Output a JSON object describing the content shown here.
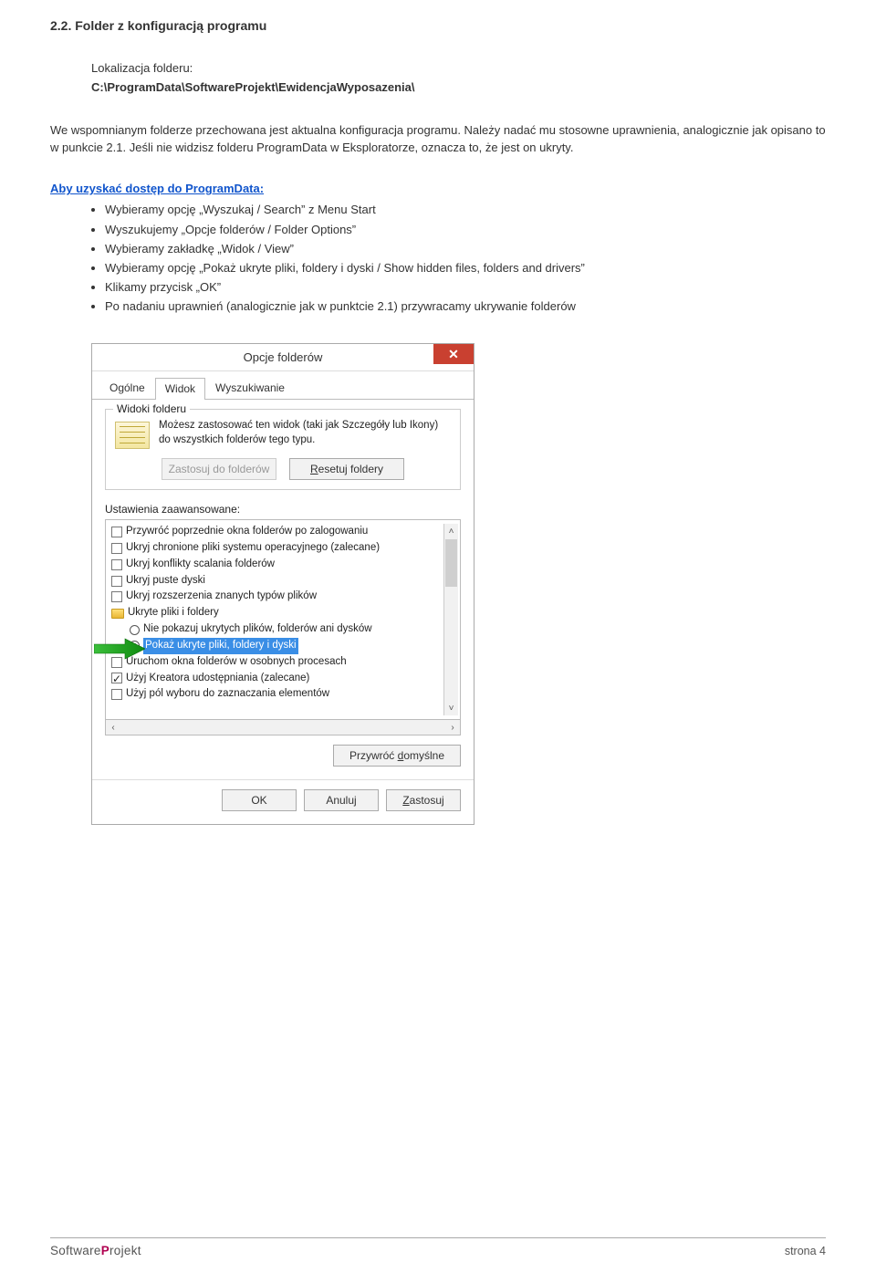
{
  "section_title": "2.2. Folder z konfiguracją programu",
  "location": {
    "label": "Lokalizacja folderu:",
    "path": "C:\\ProgramData\\SoftwareProjekt\\EwidencjaWyposazenia\\"
  },
  "para1": "We wspomnianym folderze przechowana jest aktualna konfiguracja programu. Należy nadać mu stosowne uprawnienia, analogicznie jak opisano to w punkcie 2.1. Jeśli nie widzisz folderu ProgramData w Eksploratorze, oznacza to, że jest on ukryty.",
  "access_title": "Aby uzyskać dostęp do ProgramData:",
  "bullets": [
    "Wybieramy opcję „Wyszukaj / Search” z Menu Start",
    "Wyszukujemy „Opcje folderów / Folder Options”",
    "Wybieramy zakładkę „Widok / View”",
    "Wybieramy opcję „Pokaż ukryte pliki, foldery i dyski / Show hidden files, folders and drivers”",
    "Klikamy przycisk „OK”",
    "Po nadaniu uprawnień (analogicznie jak w punktcie 2.1) przywracamy ukrywanie folderów"
  ],
  "dialog": {
    "title": "Opcje folderów",
    "close_glyph": "✕",
    "tabs": [
      "Ogólne",
      "Widok",
      "Wyszukiwanie"
    ],
    "active_tab_index": 1,
    "folderview": {
      "legend": "Widoki folderu",
      "text": "Możesz zastosować ten widok (taki jak Szczegóły lub Ikony) do wszystkich folderów tego typu.",
      "btn_apply": "Zastosuj do folderów",
      "btn_reset": "Resetuj foldery"
    },
    "advanced_label": "Ustawienia zaawansowane:",
    "tree": [
      {
        "type": "check",
        "checked": false,
        "lvl": 1,
        "label": "Przywróć poprzednie okna folderów po zalogowaniu"
      },
      {
        "type": "check",
        "checked": false,
        "lvl": 1,
        "label": "Ukryj chronione pliki systemu operacyjnego (zalecane)"
      },
      {
        "type": "check",
        "checked": false,
        "lvl": 1,
        "label": "Ukryj konflikty scalania folderów"
      },
      {
        "type": "check",
        "checked": false,
        "lvl": 1,
        "label": "Ukryj puste dyski"
      },
      {
        "type": "check",
        "checked": false,
        "lvl": 1,
        "label": "Ukryj rozszerzenia znanych typów plików"
      },
      {
        "type": "folder",
        "lvl": 1,
        "label": "Ukryte pliki i foldery"
      },
      {
        "type": "radio",
        "checked": false,
        "lvl": 2,
        "label": "Nie pokazuj ukrytych plików, folderów ani dysków"
      },
      {
        "type": "radio",
        "checked": true,
        "lvl": 2,
        "highlighted": true,
        "label": "Pokaż ukryte pliki, foldery i dyski"
      },
      {
        "type": "check",
        "checked": false,
        "lvl": 1,
        "label": "Uruchom okna folderów w osobnych procesach"
      },
      {
        "type": "check",
        "checked": true,
        "lvl": 1,
        "label": "Użyj Kreatora udostępniania (zalecane)"
      },
      {
        "type": "check",
        "checked": false,
        "lvl": 1,
        "label": "Użyj pól wyboru do zaznaczania elementów"
      }
    ],
    "restore_defaults": "Przywróć domyślne",
    "ok": "OK",
    "cancel": "Anuluj",
    "apply": "Zastosuj"
  },
  "footer": {
    "logo_p1": "Software",
    "logo_p2": "P",
    "logo_p3": "rojekt",
    "page": "strona 4"
  }
}
